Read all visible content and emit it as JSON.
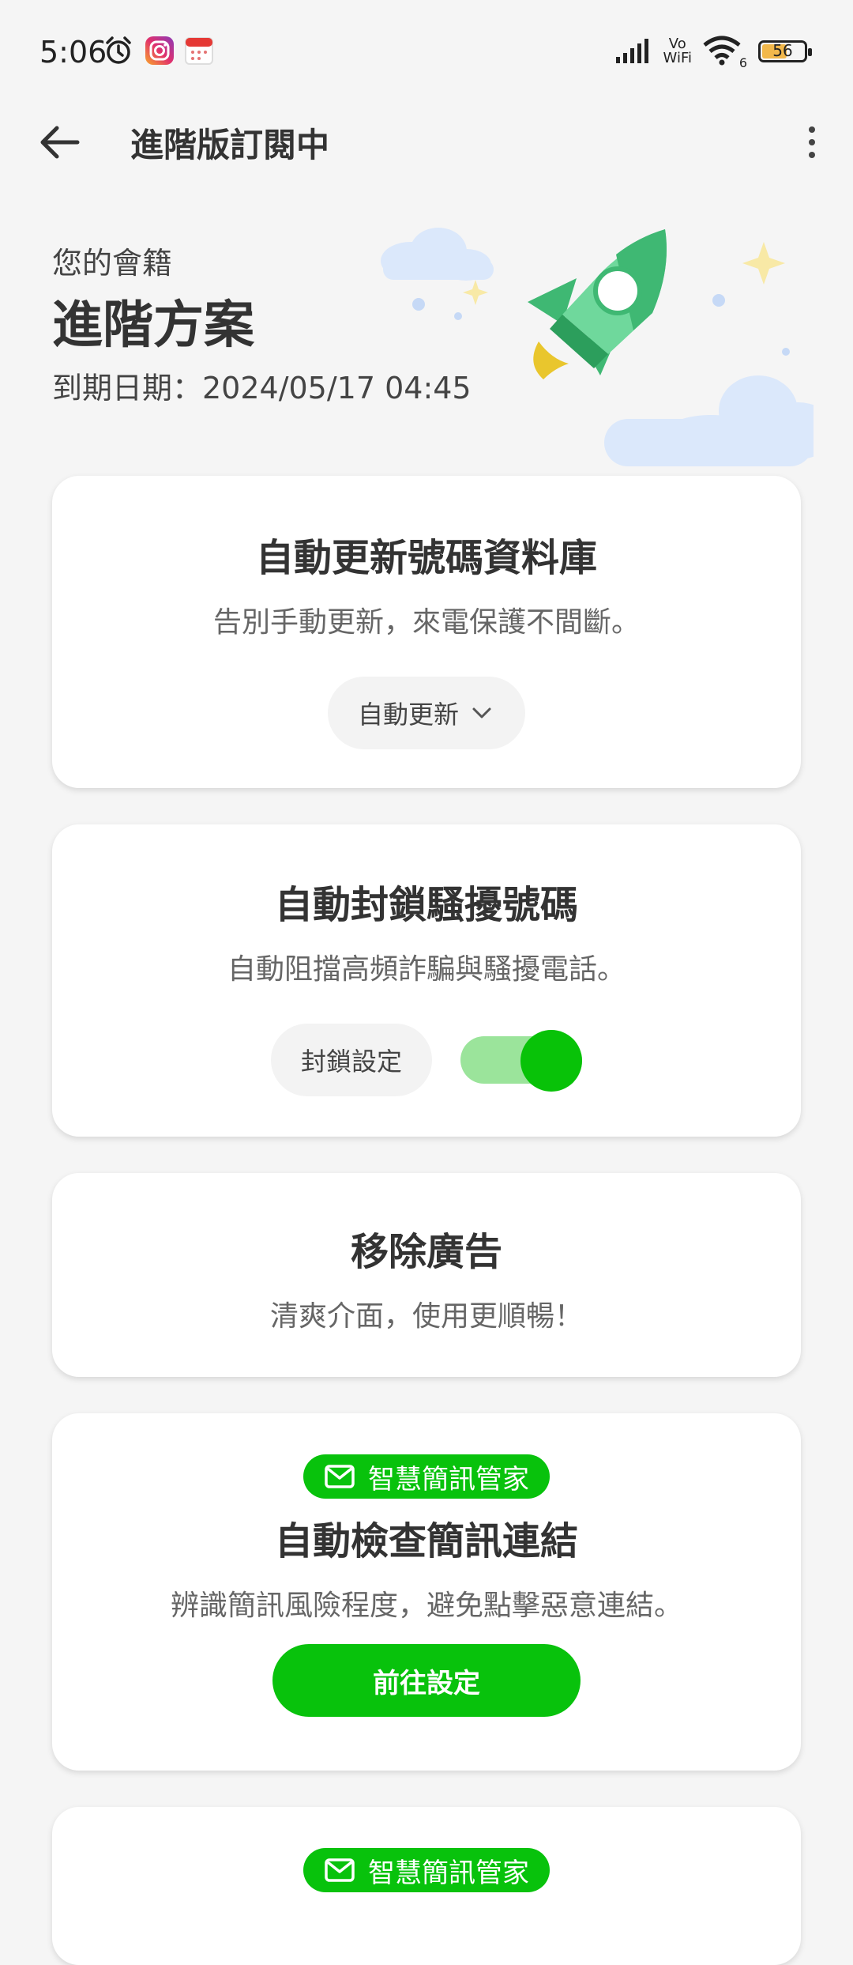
{
  "status_bar": {
    "time": "5:06",
    "vowifi_top": "Vo",
    "vowifi_bottom": "WiFi",
    "wifi_gen": "6",
    "battery": "56"
  },
  "app_bar": {
    "title": "進階版訂閱中"
  },
  "membership": {
    "label": "您的會籍",
    "plan": "進階方案",
    "expiry": "到期日期：2024/05/17 04:45"
  },
  "cards": [
    {
      "title": "自動更新號碼資料庫",
      "desc": "告別手動更新，來電保護不間斷。",
      "button": "自動更新"
    },
    {
      "title": "自動封鎖騷擾號碼",
      "desc": "自動阻擋高頻詐騙與騷擾電話。",
      "button": "封鎖設定",
      "toggle_on": true
    },
    {
      "title": "移除廣告",
      "desc": "清爽介面，使用更順暢！"
    },
    {
      "badge": "智慧簡訊管家",
      "title": "自動檢查簡訊連結",
      "desc": "辨識簡訊風險程度，避免點擊惡意連結。",
      "button": "前往設定"
    },
    {
      "badge": "智慧簡訊管家"
    }
  ],
  "colors": {
    "accent_green": "#08c20c",
    "toggle_track": "#9be49b",
    "background": "#f5f5f5"
  }
}
